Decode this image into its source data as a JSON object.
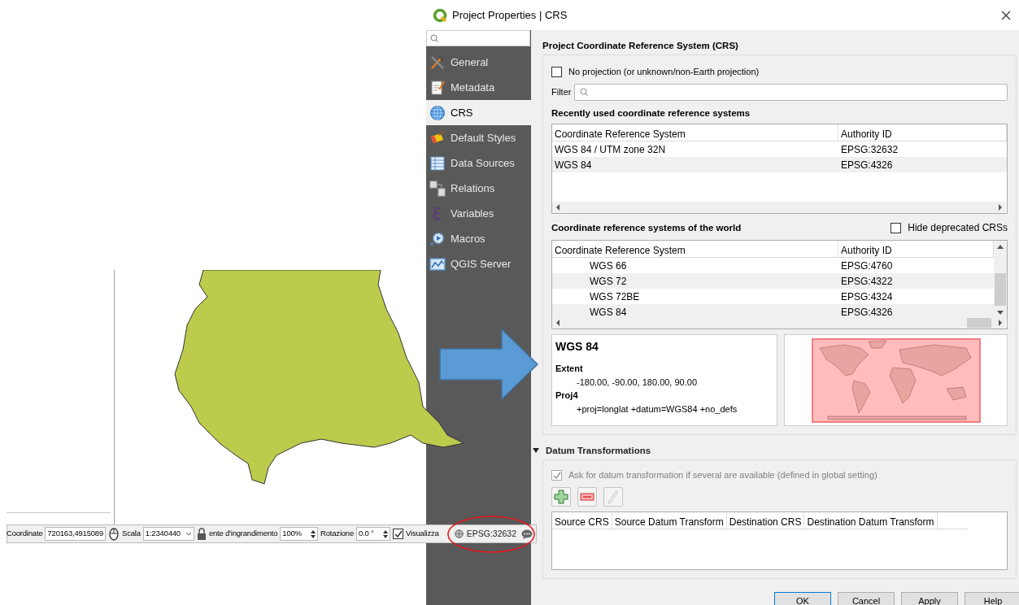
{
  "map_window": {
    "status_bar": {
      "coordinate_label": "Coordinate",
      "coordinate_value": "720163,4915089",
      "scale_label": "Scala",
      "scale_value": "1:2340440",
      "magnifier_label": "ente d'ingrandimento",
      "magnifier_value": "100%",
      "rotation_label": "Rotazione",
      "rotation_value": "0.0 °",
      "render_label": "Visualizza",
      "render_checked": true,
      "crs_button": "EPSG:32632"
    }
  },
  "dialog": {
    "title": "Project Properties | CRS",
    "sidebar": {
      "items": [
        {
          "label": "General",
          "selected": false
        },
        {
          "label": "Metadata",
          "selected": false
        },
        {
          "label": "CRS",
          "selected": true
        },
        {
          "label": "Default Styles",
          "selected": false
        },
        {
          "label": "Data Sources",
          "selected": false
        },
        {
          "label": "Relations",
          "selected": false
        },
        {
          "label": "Variables",
          "selected": false
        },
        {
          "label": "Macros",
          "selected": false
        },
        {
          "label": "QGIS Server",
          "selected": false
        }
      ]
    },
    "crs_heading": "Project Coordinate Reference System (CRS)",
    "no_projection": {
      "label": "No projection (or unknown/non-Earth projection)",
      "checked": false
    },
    "filter_label": "Filter",
    "recent": {
      "heading": "Recently used coordinate reference systems",
      "columns": [
        "Coordinate Reference System",
        "Authority ID"
      ],
      "rows": [
        [
          "WGS 84 / UTM zone 32N",
          "EPSG:32632"
        ],
        [
          "WGS 84",
          "EPSG:4326"
        ]
      ]
    },
    "world": {
      "heading": "Coordinate reference systems of the world",
      "hide_deprecated": {
        "label": "Hide deprecated CRSs",
        "checked": false
      },
      "columns": [
        "Coordinate Reference System",
        "Authority ID"
      ],
      "rows": [
        [
          "WGS 66",
          "EPSG:4760"
        ],
        [
          "WGS 72",
          "EPSG:4322"
        ],
        [
          "WGS 72BE",
          "EPSG:4324"
        ],
        [
          "WGS 84",
          "EPSG:4326"
        ]
      ]
    },
    "info": {
      "title": "WGS 84",
      "extent_label": "Extent",
      "extent": "-180.00, -90.00, 180.00, 90.00",
      "proj4_label": "Proj4",
      "proj4": "+proj=longlat +datum=WGS84 +no_defs"
    },
    "datum": {
      "heading": "Datum Transformations",
      "expanded": true,
      "ask": {
        "label": "Ask for datum transformation if several are available (defined in global setting)",
        "checked": true,
        "disabled": true
      },
      "columns": [
        "Source CRS",
        "Source Datum Transform",
        "Destination CRS",
        "Destination Datum Transform"
      ]
    },
    "buttons": [
      "OK",
      "Cancel",
      "Apply",
      "Help"
    ]
  }
}
